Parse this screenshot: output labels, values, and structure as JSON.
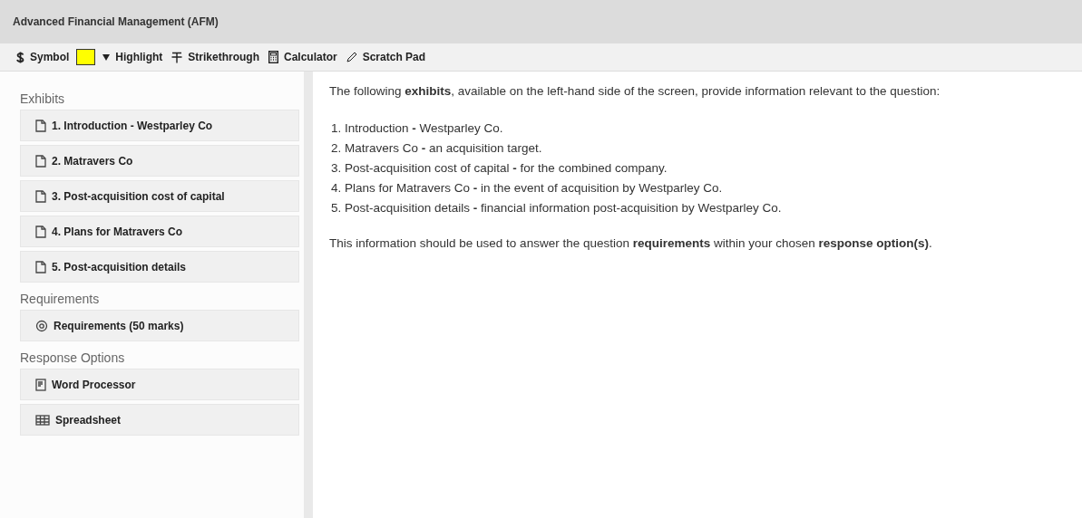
{
  "window": {
    "title": "Advanced Financial Management (AFM)"
  },
  "toolbar": [
    {
      "kind": "symbol",
      "label": "Symbol"
    },
    {
      "kind": "highlight",
      "label": "Highlight",
      "color": "#ffff00"
    },
    {
      "kind": "strikethrough",
      "label": "Strikethrough"
    },
    {
      "kind": "calculator",
      "label": "Calculator"
    },
    {
      "kind": "scratchpad",
      "label": "Scratch Pad"
    }
  ],
  "sidebar": {
    "sections": [
      {
        "heading": "Exhibits",
        "items": [
          {
            "kind": "document",
            "label": "1. Introduction - Westparley Co"
          },
          {
            "kind": "document",
            "label": "2. Matravers Co"
          },
          {
            "kind": "document",
            "label": "3. Post-acquisition cost of capital"
          },
          {
            "kind": "document",
            "label": "4. Plans for Matravers Co"
          },
          {
            "kind": "document",
            "label": "5. Post-acquisition details"
          }
        ]
      },
      {
        "heading": "Requirements",
        "items": [
          {
            "kind": "target",
            "label": "Requirements (50 marks)"
          }
        ]
      },
      {
        "heading": "Response Options",
        "items": [
          {
            "kind": "page",
            "label": "Word Processor"
          },
          {
            "kind": "grid",
            "label": "Spreadsheet"
          }
        ]
      }
    ]
  },
  "content": {
    "intro": "The following **exhibits**, available on the left-hand side of the screen, provide information relevant to the question:",
    "list": [
      "1. Introduction **-** Westparley Co.",
      "2. Matravers Co **-** an acquisition target.",
      "3. Post-acquisition cost of capital **-** for the combined company.",
      "4. Plans for Matravers Co **-** in the event of acquisition by Westparley Co.",
      "5. Post-acquisition details **-** financial information post-acquisition by Westparley Co."
    ],
    "outro": "This information should be used to answer the question **requirements** within your chosen **response option(s)**."
  }
}
